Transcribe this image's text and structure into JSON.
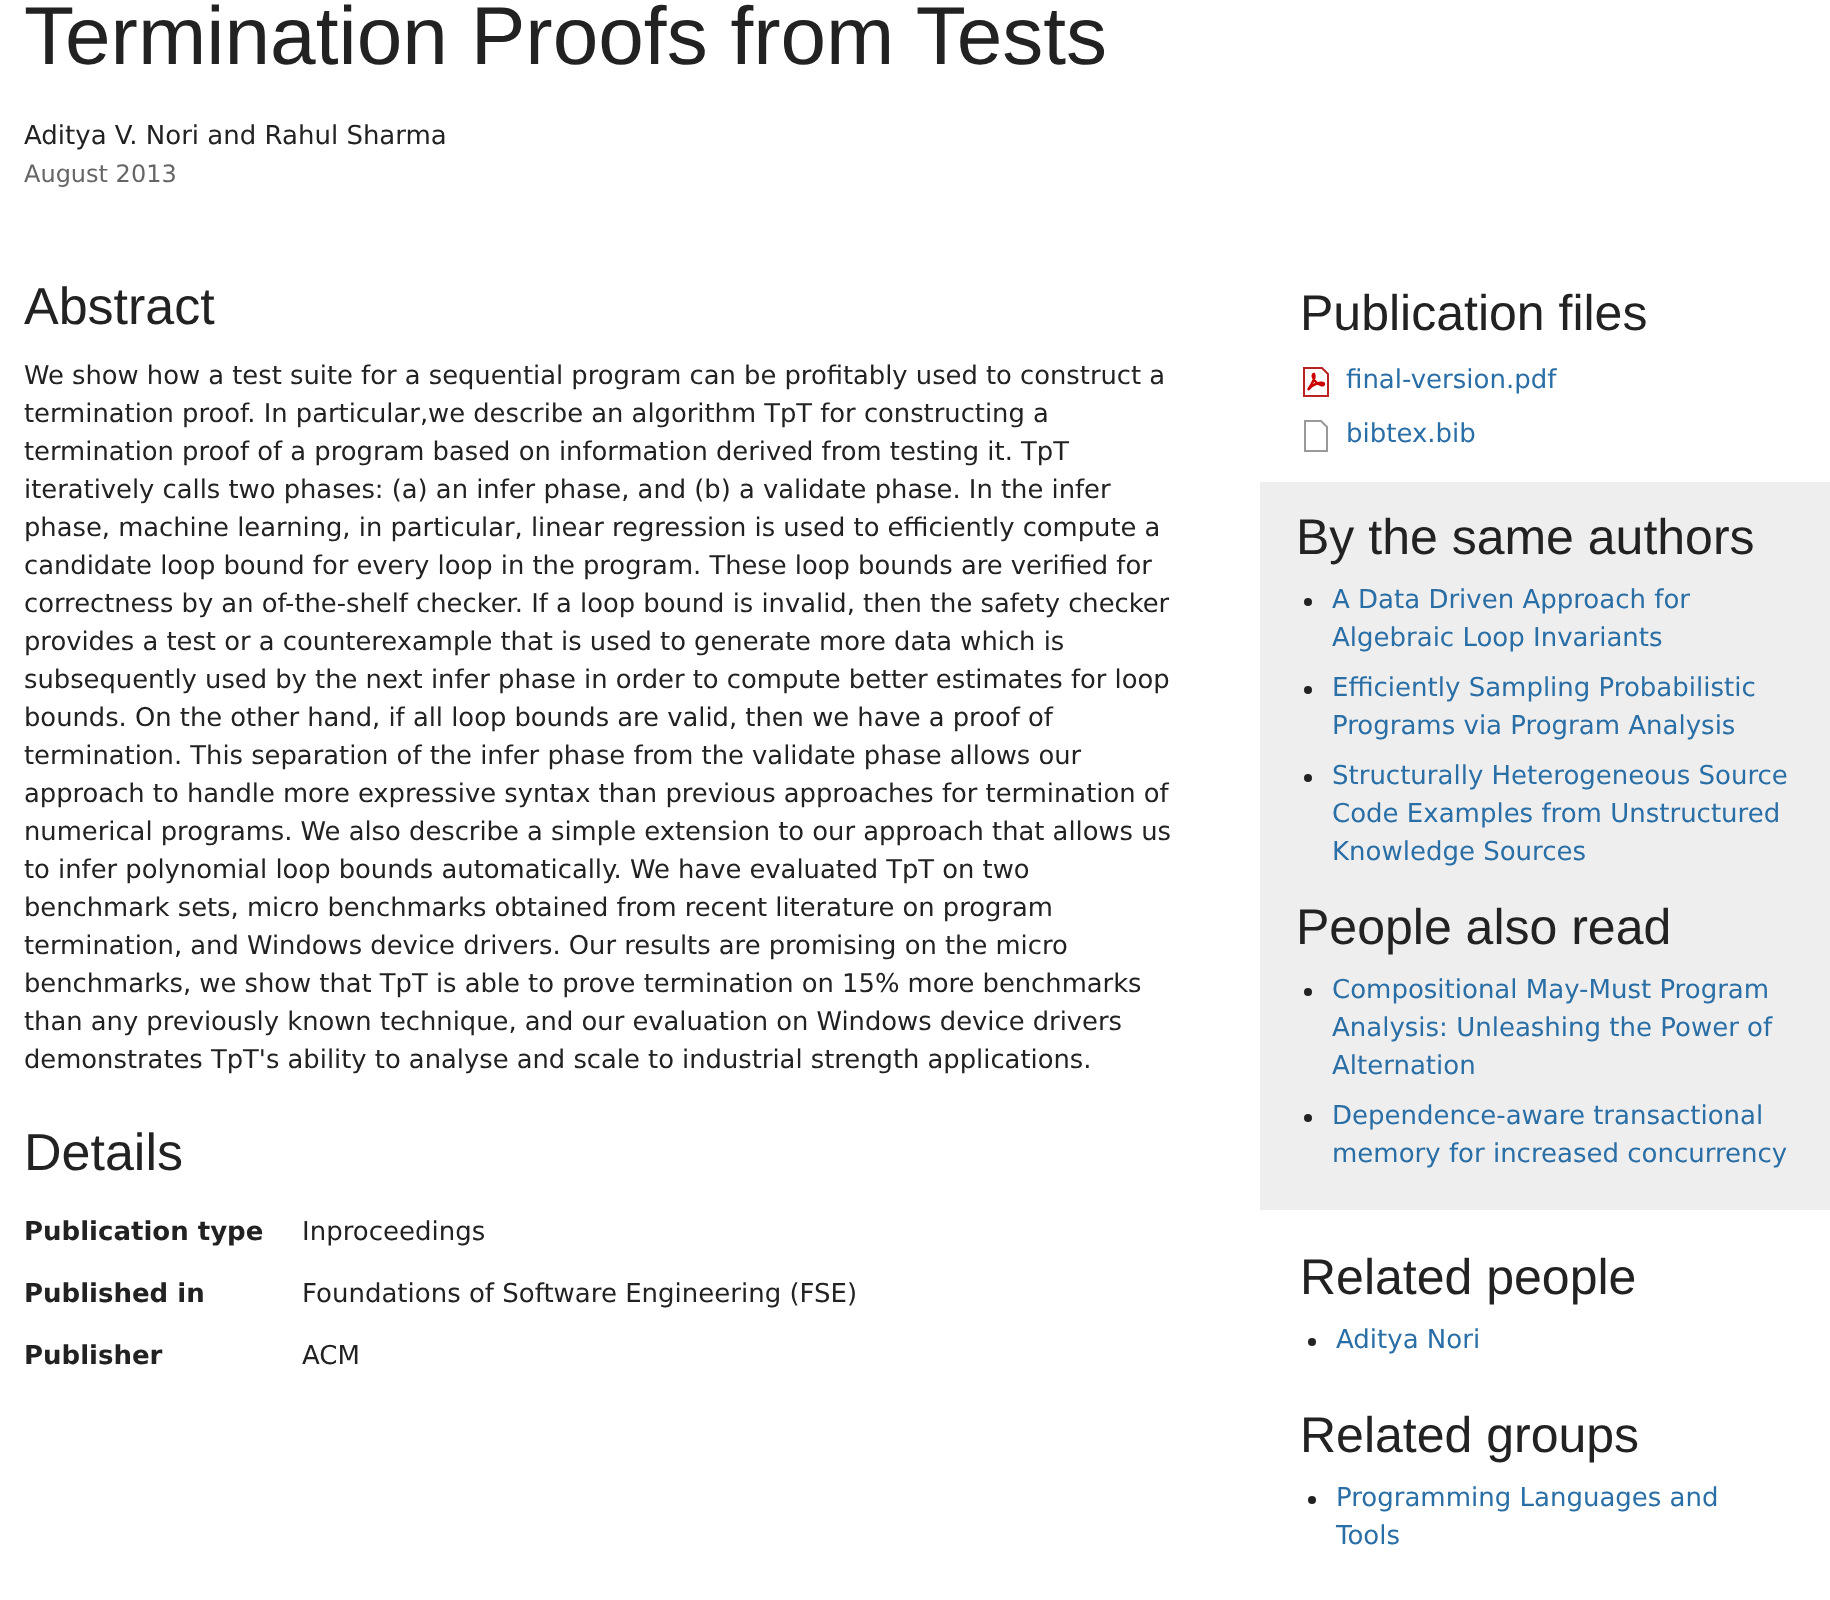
{
  "title": "Termination Proofs from Tests",
  "authors": "Aditya V. Nori and Rahul Sharma",
  "date": "August 2013",
  "abstract": {
    "heading": "Abstract",
    "text": "We show how a test suite for a sequential program can be profitably used to construct a termination proof. In particular,we describe an algorithm TpT for constructing a termination proof of a program based on information derived from testing it. TpT iteratively calls two phases: (a) an infer phase, and (b) a validate phase. In the infer phase, machine learning, in particular, linear regression is used to efficiently compute a candidate loop bound for every loop in the program. These loop bounds are verified for correctness by an of-the-shelf checker. If a loop bound is invalid, then the safety checker provides a test or a counterexample that is used to generate more data which is subsequently used by the next infer phase in order to compute better estimates for loop bounds. On the other hand, if all loop bounds are valid, then we have a proof of termination. This separation of the infer phase from the validate phase allows our approach to handle more expressive syntax than previous approaches for termination of numerical programs. We also describe a simple extension to our approach that allows us to infer polynomial loop bounds automatically. We have evaluated TpT on two benchmark sets, micro benchmarks obtained from recent literature on program termination, and Windows device drivers. Our results are promising on the micro benchmarks, we show that TpT is able to prove termination on 15% more benchmarks than any previously known technique, and our evaluation on Windows device drivers demonstrates TpT's ability to analyse and scale to industrial strength applications."
  },
  "details": {
    "heading": "Details",
    "rows": [
      {
        "label": "Publication type",
        "value": "Inproceedings"
      },
      {
        "label": "Published in",
        "value": "Foundations of Software Engineering (FSE)"
      },
      {
        "label": "Publisher",
        "value": "ACM"
      }
    ]
  },
  "publication_files": {
    "heading": "Publication files",
    "files": [
      {
        "name": "final-version.pdf",
        "kind": "pdf"
      },
      {
        "name": "bibtex.bib",
        "kind": "file"
      }
    ]
  },
  "same_authors": {
    "heading": "By the same authors",
    "items": [
      "A Data Driven Approach for Algebraic Loop Invariants",
      "Efficiently Sampling Probabilistic Programs via Program Analysis",
      "Structurally Heterogeneous Source Code Examples from Unstructured Knowledge Sources"
    ]
  },
  "also_read": {
    "heading": "People also read",
    "items": [
      "Compositional May-Must Program Analysis: Unleashing the Power of Alternation",
      "Dependence-aware transactional memory for increased concurrency"
    ]
  },
  "related_people": {
    "heading": "Related people",
    "items": [
      "Aditya Nori"
    ]
  },
  "related_groups": {
    "heading": "Related groups",
    "items": [
      "Programming Languages and Tools"
    ]
  }
}
